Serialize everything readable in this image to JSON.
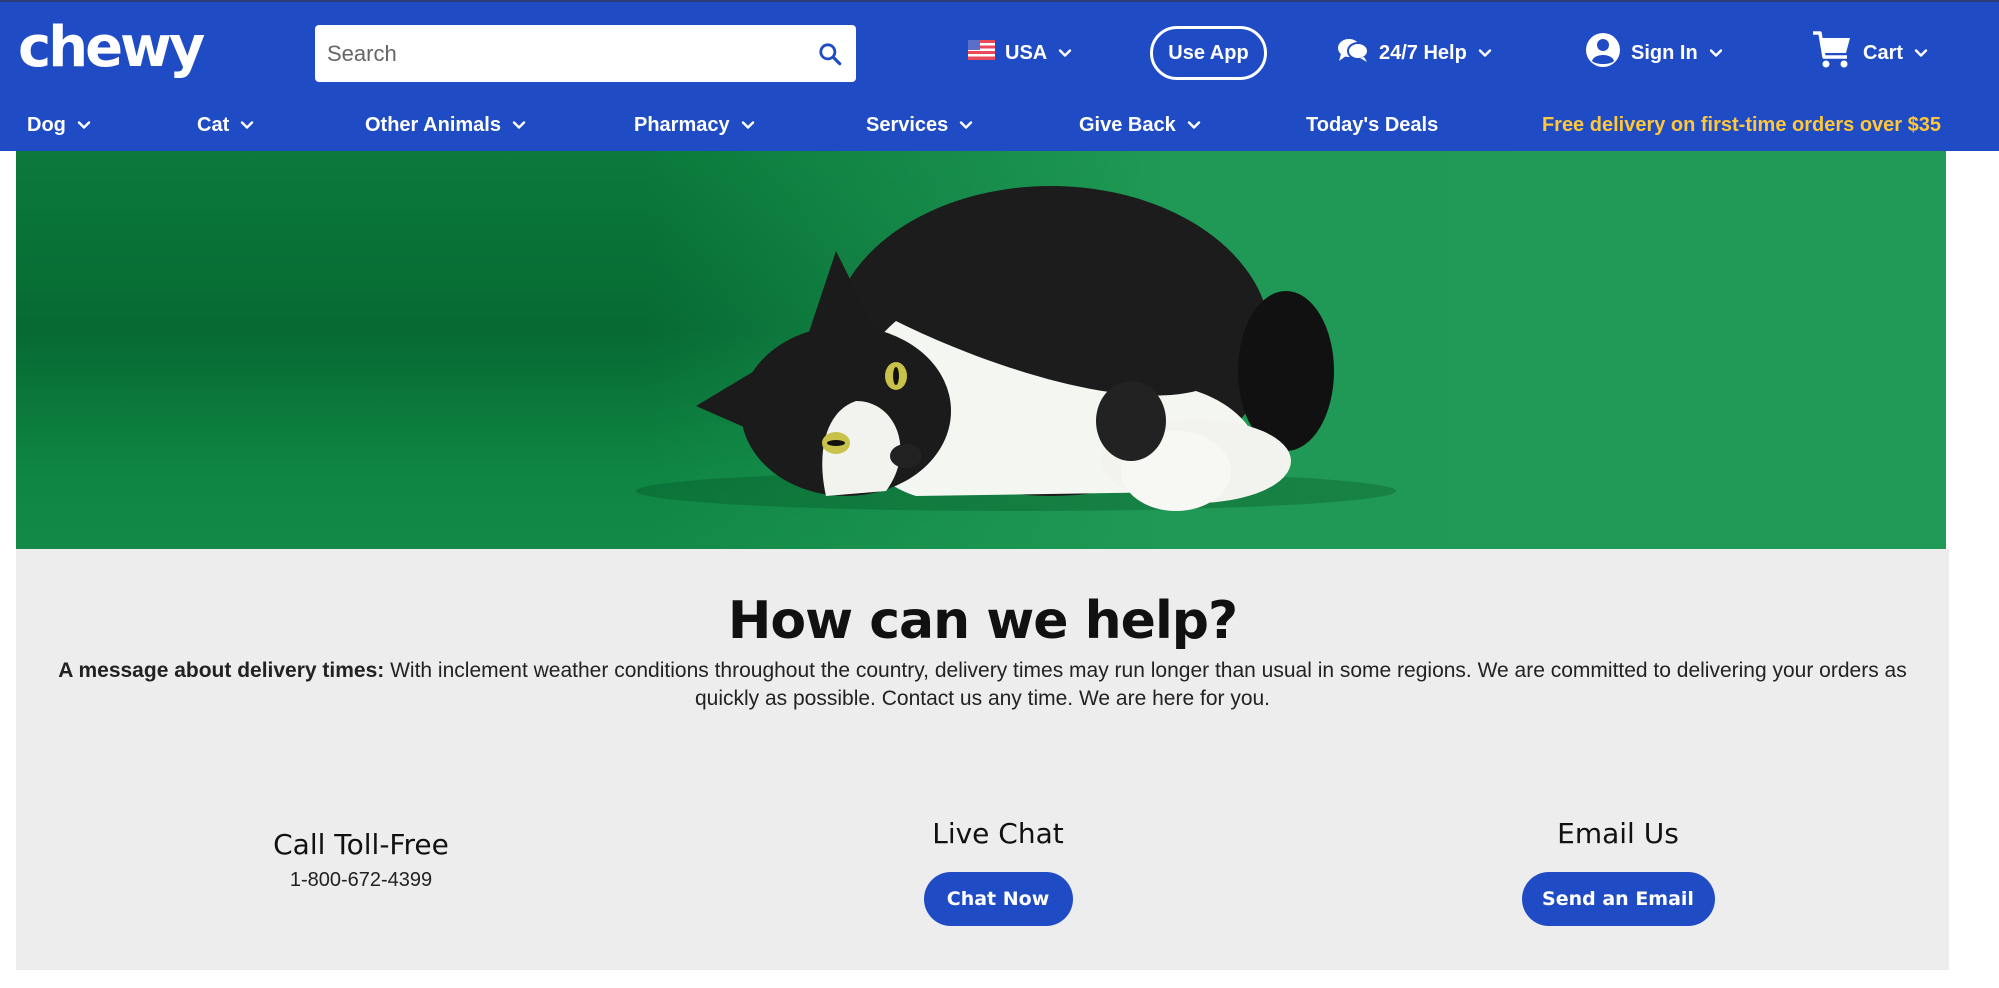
{
  "brand": {
    "logo_text": "chewy",
    "primary_color": "#1f4bc4",
    "promo_color": "#ffc73a"
  },
  "header": {
    "search_placeholder": "Search",
    "country": {
      "flag": "us-flag-icon",
      "label": "USA"
    },
    "use_app_label": "Use App",
    "help": {
      "icon": "chat-bubbles-icon",
      "label": "24/7 Help"
    },
    "sign_in": {
      "icon": "account-icon",
      "label": "Sign In"
    },
    "cart": {
      "icon": "cart-icon",
      "label": "Cart"
    }
  },
  "nav": {
    "items": [
      {
        "label": "Dog",
        "has_dropdown": true
      },
      {
        "label": "Cat",
        "has_dropdown": true
      },
      {
        "label": "Other Animals",
        "has_dropdown": true
      },
      {
        "label": "Pharmacy",
        "has_dropdown": true
      },
      {
        "label": "Services",
        "has_dropdown": true
      },
      {
        "label": "Give Back",
        "has_dropdown": true
      },
      {
        "label": "Today's Deals",
        "has_dropdown": false
      }
    ],
    "promo": "Free delivery on first-time orders over $35"
  },
  "hero": {
    "image_description": "Black and white tuxedo cat lying on green background"
  },
  "help": {
    "title": "How can we help?",
    "message_label": "A message about delivery times:",
    "message_text": " With inclement weather conditions throughout the country, delivery times may run longer than usual in some regions. We are committed to delivering your orders as quickly as possible. Contact us any time. We are here for you.",
    "contacts": [
      {
        "title": "Call Toll-Free",
        "phone": "1-800-672-4399"
      },
      {
        "title": "Live Chat",
        "button": "Chat Now"
      },
      {
        "title": "Email Us",
        "button": "Send an Email"
      }
    ]
  }
}
